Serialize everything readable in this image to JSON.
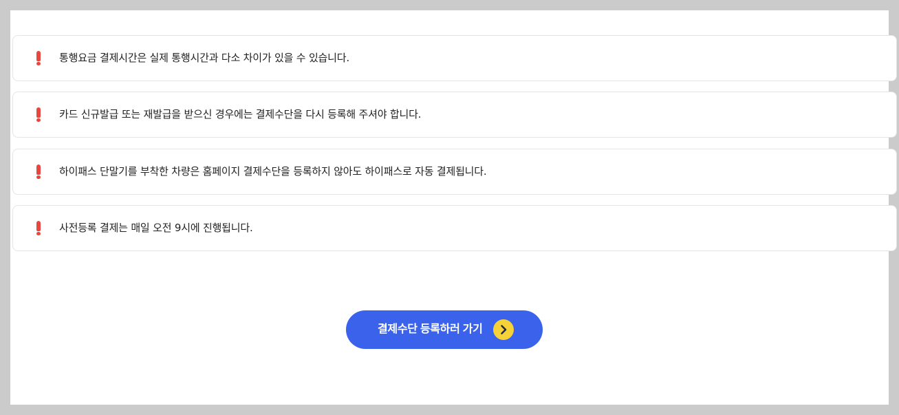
{
  "notices": [
    {
      "icon": "exclamation-icon",
      "text": "통행요금 결제시간은 실제 통행시간과 다소 차이가 있을 수 있습니다."
    },
    {
      "icon": "exclamation-icon",
      "text": "카드 신규발급 또는 재발급을 받으신 경우에는 결제수단을 다시 등록해 주셔야 합니다."
    },
    {
      "icon": "exclamation-icon",
      "text": "하이패스 단말기를 부착한 차량은 홈페이지 결제수단을 등록하지 않아도 하이패스로 자동 결제됩니다."
    },
    {
      "icon": "exclamation-icon",
      "text": "사전등록 결제는 매일 오전 9시에 진행됩니다."
    }
  ],
  "cta": {
    "label": "결제수단 등록하러 가기",
    "icon": "chevron-right-icon"
  },
  "colors": {
    "background": "#cbcbcb",
    "panel": "#ffffff",
    "notice_border": "#e4e4e4",
    "exclamation": "#e8473f",
    "cta_background": "#3a62eb",
    "cta_arrow_circle": "#f6d238"
  }
}
